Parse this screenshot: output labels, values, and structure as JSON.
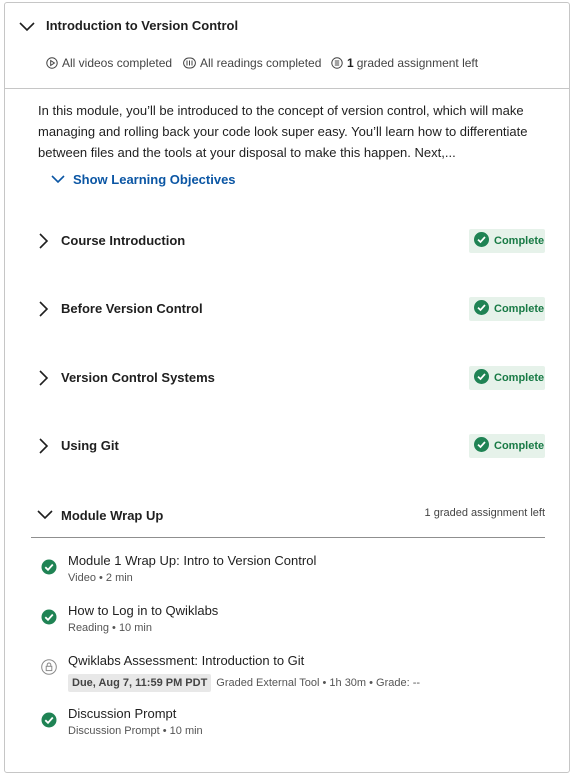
{
  "module": {
    "title": "Introduction to Version Control",
    "stats": {
      "videos": "All videos completed",
      "readings": "All readings completed",
      "graded_count": "1",
      "graded_text": "graded assignment left"
    },
    "description": "In this module, you’ll be introduced to the concept of version control, which will make managing and rolling back your code look super easy. You’ll learn how to differentiate between files and the tools at your disposal to make this happen. Next,...",
    "show_objectives": "Show Learning Objectives"
  },
  "lessons": [
    {
      "title": "Course Introduction",
      "status": "Complete"
    },
    {
      "title": "Before Version Control",
      "status": "Complete"
    },
    {
      "title": "Version Control Systems",
      "status": "Complete"
    },
    {
      "title": "Using Git",
      "status": "Complete"
    }
  ],
  "wrap_up": {
    "title": "Module Wrap Up",
    "meta": "1 graded assignment left",
    "items": [
      {
        "title": "Module 1 Wrap Up: Intro to Version Control",
        "meta": "Video • 2 min",
        "state": "complete"
      },
      {
        "title": "How to Log in to Qwiklabs",
        "meta": "Reading • 10 min",
        "state": "complete"
      },
      {
        "title": "Qwiklabs Assessment: Introduction to Git",
        "due": "Due, Aug 7, 11:59 PM PDT",
        "meta": "Graded External Tool • 1h 30m • Grade: --",
        "state": "locked"
      },
      {
        "title": "Discussion Prompt",
        "meta": "Discussion Prompt • 10 min",
        "state": "complete"
      }
    ]
  },
  "colors": {
    "accent": "#0b56a4",
    "complete_green": "#1f8354",
    "complete_bg": "#e6f2ea"
  }
}
